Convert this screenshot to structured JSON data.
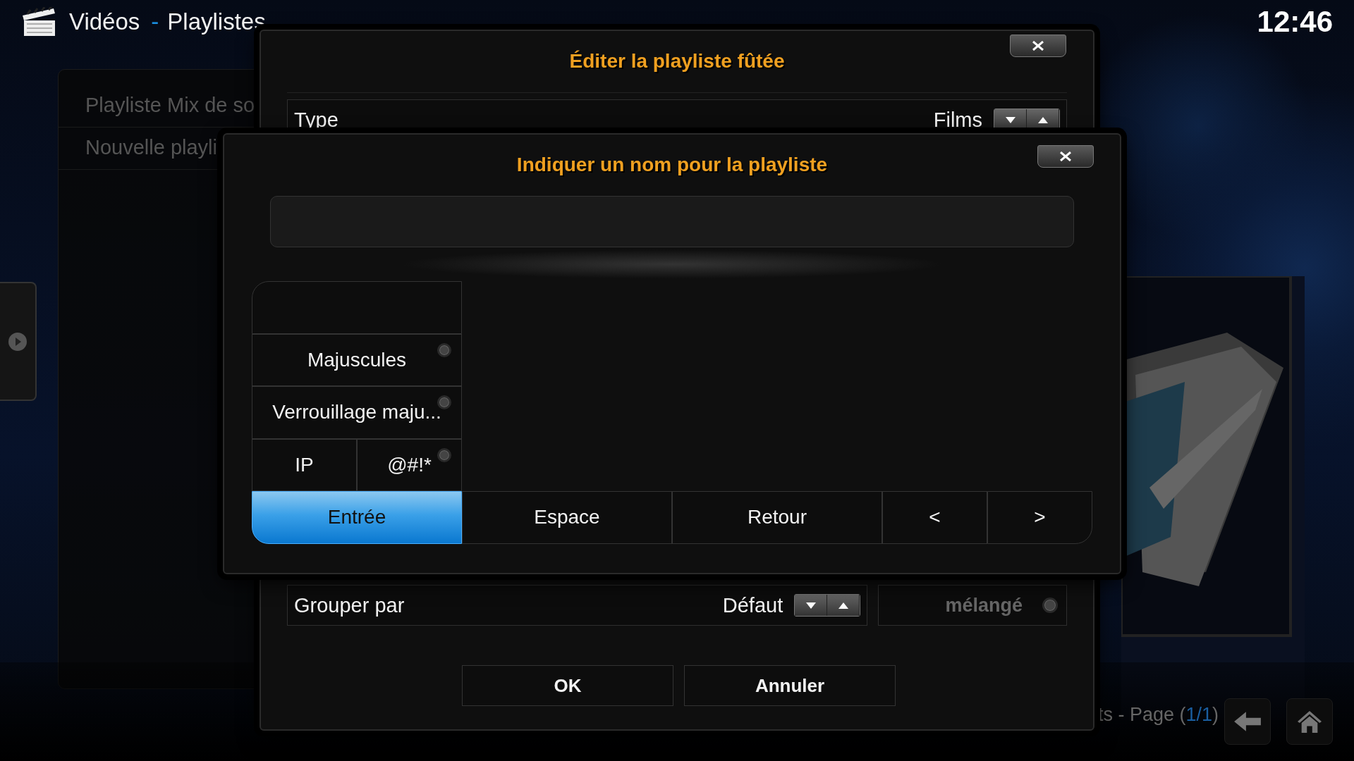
{
  "header": {
    "section": "Vidéos",
    "separator": "-",
    "page": "Playlistes",
    "clock": "12:46"
  },
  "playlists": [
    {
      "label": "Playliste Mix de so"
    },
    {
      "label": "Nouvelle playli"
    }
  ],
  "footer": {
    "text": "ts - Page (",
    "page": "1/1",
    "end": ")"
  },
  "smart_playlist_dialog": {
    "title": "Éditer la playliste fûtée",
    "type_row": {
      "label": "Type",
      "value": "Films"
    },
    "group_row": {
      "label": "Grouper par",
      "value": "Défaut"
    },
    "shuffle": {
      "label": "mélangé",
      "on": false,
      "disabled": true
    },
    "buttons": [
      "OK",
      "Annuler"
    ]
  },
  "keyboard_dialog": {
    "title": "Indiquer un nom pour la playliste",
    "keys": [
      {
        "label": "Majuscules",
        "kind": "toggle",
        "wide": true,
        "on": false,
        "selected": false
      },
      {
        "label": "Verrouillage maju...",
        "kind": "toggle",
        "wide": true,
        "on": false,
        "selected": false
      },
      {
        "label": "IP",
        "kind": "key",
        "wide": false,
        "selected": false
      },
      {
        "label": "@#!*",
        "kind": "toggle",
        "wide": false,
        "on": false,
        "selected": false
      },
      {
        "label": "Entrée",
        "kind": "key",
        "wide": true,
        "selected": true
      },
      {
        "label": "Espace",
        "kind": "key",
        "wide": true,
        "selected": false
      },
      {
        "label": "Retour",
        "kind": "key",
        "wide": true,
        "selected": false
      },
      {
        "label": "<",
        "kind": "key",
        "wide": false,
        "selected": false
      },
      {
        "label": ">",
        "kind": "key",
        "wide": false,
        "selected": false
      }
    ]
  }
}
